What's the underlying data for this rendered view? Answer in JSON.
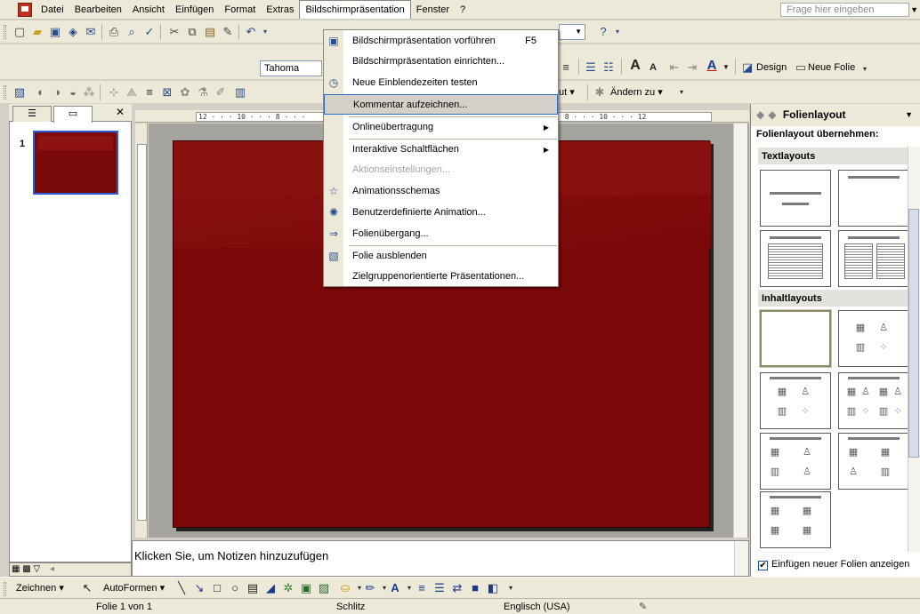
{
  "menubar": {
    "items": [
      "Datei",
      "Bearbeiten",
      "Ansicht",
      "Einfügen",
      "Format",
      "Extras",
      "Bildschirmpräsentation",
      "Fenster",
      "?"
    ],
    "help_placeholder": "Frage hier eingeben"
  },
  "formatting": {
    "font": "Tahoma",
    "design_label": "Design",
    "new_slide_label": "Neue Folie"
  },
  "toolbar3": {
    "layout_label": "ut",
    "change_to_label": "Ändern zu"
  },
  "left_pane": {
    "slide_number": "1"
  },
  "ruler": {
    "horizontal_left": "12 · · · 10 · · · 8 · · ·",
    "horizontal_right": "6 · · · 8 · · · 10 · · · 12"
  },
  "notes": {
    "placeholder": "Klicken Sie, um Notizen hinzuzufügen"
  },
  "taskpane": {
    "title": "Folienlayout",
    "apply_label": "Folienlayout übernehmen:",
    "section_text": "Textlayouts",
    "section_content": "Inhaltlayouts",
    "show_on_insert": "Einfügen neuer Folien anzeigen"
  },
  "drawbar": {
    "draw_label": "Zeichnen",
    "autoshapes_label": "AutoFormen"
  },
  "statusbar": {
    "slide_info": "Folie 1 von 1",
    "design": "Schlitz",
    "language": "Englisch (USA)"
  },
  "dropdown": {
    "items": [
      {
        "label": "Bildschirmpräsentation vorführen",
        "shortcut": "F5",
        "icon": "slideshow-icon"
      },
      {
        "label": "Bildschirmpräsentation einrichten..."
      },
      {
        "label": "Neue Einblendezeiten testen",
        "icon": "rehearse-timings-icon"
      },
      {
        "label": "Kommentar aufzeichnen..."
      },
      {
        "label": "Onlineübertragung",
        "submenu": true
      },
      {
        "label": "Interaktive Schaltflächen",
        "submenu": true
      },
      {
        "label": "Aktionseinstellungen...",
        "disabled": true
      },
      {
        "label": "Animationsschemas",
        "icon": "animation-schemes-icon"
      },
      {
        "label": "Benutzerdefinierte Animation...",
        "icon": "custom-animation-icon"
      },
      {
        "label": "Folienübergang...",
        "icon": "slide-transition-icon"
      },
      {
        "label": "Folie ausblenden",
        "icon": "hide-slide-icon"
      },
      {
        "label": "Zielgruppenorientierte Präsentationen..."
      }
    ]
  }
}
